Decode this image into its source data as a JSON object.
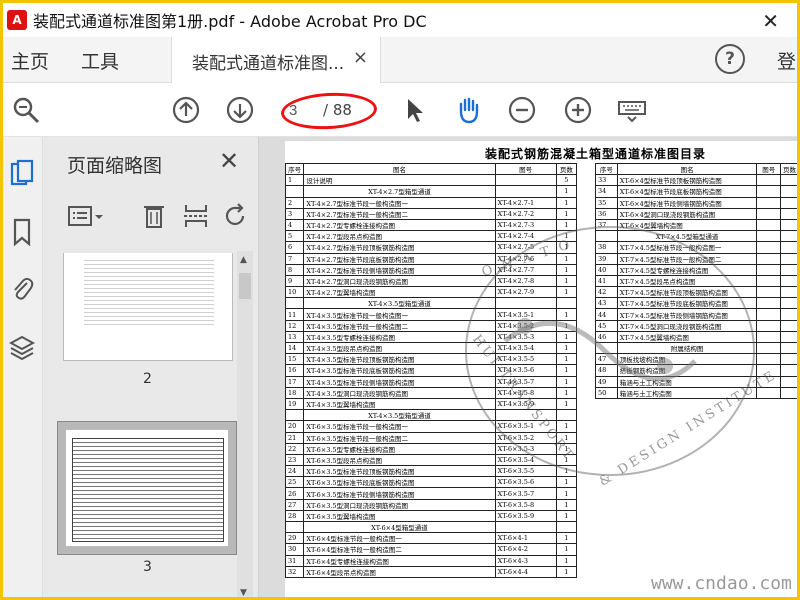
{
  "window": {
    "title": "装配式通道标准图第1册.pdf - Adobe Acrobat Pro DC",
    "close_glyph": "✕"
  },
  "tabbar": {
    "home": "主页",
    "tools": "工具",
    "doc_tab": "装配式通道标准图...",
    "doc_tab_close": "×",
    "help": "?",
    "login": "登"
  },
  "toolbar": {
    "page_current": "3",
    "page_total": "/ 88",
    "icons": [
      "zoom-icon",
      "prev-page-icon",
      "next-page-icon",
      "select-cursor-icon",
      "hand-icon",
      "zoom-out-icon",
      "zoom-in-icon",
      "keyboard-icon"
    ]
  },
  "thumbnails": {
    "title": "页面缩略图",
    "close": "✕",
    "pages": [
      {
        "label": "2"
      },
      {
        "label": "3"
      }
    ]
  },
  "document": {
    "title": "装配式钢筋混凝土箱型通道标准图目录",
    "left_headers": [
      "序号",
      "图名",
      "图号",
      "页数"
    ],
    "right_headers": [
      "序号",
      "图名",
      "图号",
      "页数"
    ],
    "left_rows": [
      {
        "no": "1",
        "name": "设计说明",
        "code": "",
        "pages": "5"
      },
      {
        "no": "",
        "name": "XT-4×2.7型箱型通道",
        "code": "",
        "pages": "1",
        "section": true
      },
      {
        "no": "2",
        "name": "XT-4×2.7型标准节段一般构造图一",
        "code": "XT-4×2.7-1",
        "pages": "1"
      },
      {
        "no": "3",
        "name": "XT-4×2.7型标准节段一般构造图二",
        "code": "XT-4×2.7-2",
        "pages": "1"
      },
      {
        "no": "4",
        "name": "XT-4×2.7型专螺栓连接构造图",
        "code": "XT-4×2.7-3",
        "pages": "1"
      },
      {
        "no": "5",
        "name": "XT-4×2.7型段吊点构造图",
        "code": "XT-4×2.7-4",
        "pages": "1"
      },
      {
        "no": "6",
        "name": "XT-4×2.7型标准节段顶板钢筋构造图",
        "code": "XT-4×2.7-5",
        "pages": "1"
      },
      {
        "no": "7",
        "name": "XT-4×2.7型标准节段底板钢筋构造图",
        "code": "XT-4×2.7-6",
        "pages": "1"
      },
      {
        "no": "8",
        "name": "XT-4×2.7型标准节段侧墙钢筋构造图",
        "code": "XT-4×2.7-7",
        "pages": "1"
      },
      {
        "no": "9",
        "name": "XT-4×2.7型洞口现浇段钢筋构造图",
        "code": "XT-4×2.7-8",
        "pages": "1"
      },
      {
        "no": "10",
        "name": "XT-4×2.7型翼墙构造图",
        "code": "XT-4×2.7-9",
        "pages": "1"
      },
      {
        "no": "",
        "name": "XT-4×3.5型箱型通道",
        "code": "",
        "pages": "",
        "section": true
      },
      {
        "no": "11",
        "name": "XT-4×3.5型标准节段一般构造图一",
        "code": "XT-4×3.5-1",
        "pages": "1"
      },
      {
        "no": "12",
        "name": "XT-4×3.5型标准节段一般构造图二",
        "code": "XT-4×3.5-2",
        "pages": "1"
      },
      {
        "no": "13",
        "name": "XT-4×3.5型专螺栓连接构造图",
        "code": "XT-4×3.5-3",
        "pages": "1"
      },
      {
        "no": "14",
        "name": "XT-4×3.5型段吊点构造图",
        "code": "XT-4×3.5-4",
        "pages": "1"
      },
      {
        "no": "15",
        "name": "XT-4×3.5型标准节段顶板钢筋构造图",
        "code": "XT-4×3.5-5",
        "pages": "1"
      },
      {
        "no": "16",
        "name": "XT-4×3.5型标准节段底板钢筋构造图",
        "code": "XT-4×3.5-6",
        "pages": "1"
      },
      {
        "no": "17",
        "name": "XT-4×3.5型标准节段侧墙钢筋构造图",
        "code": "XT-4×3.5-7",
        "pages": "1"
      },
      {
        "no": "18",
        "name": "XT-4×3.5型洞口现浇段钢筋构造图",
        "code": "XT-4×3.5-8",
        "pages": "1"
      },
      {
        "no": "19",
        "name": "XT-4×3.5型翼墙构造图",
        "code": "XT-4×3.5-9",
        "pages": "1"
      },
      {
        "no": "",
        "name": "XT-4×3.5型箱型通道",
        "code": "",
        "pages": "",
        "section": true
      },
      {
        "no": "20",
        "name": "XT-6×3.5型标准节段一般构造图一",
        "code": "XT-6×3.5-1",
        "pages": "1"
      },
      {
        "no": "21",
        "name": "XT-6×3.5型标准节段一般构造图二",
        "code": "XT-6×3.5-2",
        "pages": "1"
      },
      {
        "no": "22",
        "name": "XT-6×3.5型专螺栓连接构造图",
        "code": "XT-6×3.5-3",
        "pages": "1"
      },
      {
        "no": "23",
        "name": "XT-6×3.5型段吊点构造图",
        "code": "XT-6×3.5-4",
        "pages": "1"
      },
      {
        "no": "24",
        "name": "XT-6×3.5型标准节段顶板钢筋构造图",
        "code": "XT-6×3.5-5",
        "pages": "1"
      },
      {
        "no": "25",
        "name": "XT-6×3.5型标准节段底板钢筋构造图",
        "code": "XT-6×3.5-6",
        "pages": "1"
      },
      {
        "no": "26",
        "name": "XT-6×3.5型标准节段侧墙钢筋构造图",
        "code": "XT-6×3.5-7",
        "pages": "1"
      },
      {
        "no": "27",
        "name": "XT-6×3.5型洞口现浇段钢筋构造图",
        "code": "XT-6×3.5-8",
        "pages": "1"
      },
      {
        "no": "28",
        "name": "XT-6×3.5型翼墙构造图",
        "code": "XT-6×3.5-9",
        "pages": "1"
      },
      {
        "no": "",
        "name": "XT-6×4型箱型通道",
        "code": "",
        "pages": "",
        "section": true
      },
      {
        "no": "29",
        "name": "XT-6×4型标准节段一般构造图一",
        "code": "XT-6×4-1",
        "pages": "1"
      },
      {
        "no": "30",
        "name": "XT-6×4型标准节段一般构造图二",
        "code": "XT-6×4-2",
        "pages": "1"
      },
      {
        "no": "31",
        "name": "XT-6×4型专螺栓连接构造图",
        "code": "XT-6×4-3",
        "pages": "1"
      },
      {
        "no": "32",
        "name": "XT-6×4型段吊点构造图",
        "code": "XT-6×4-4",
        "pages": "1"
      }
    ],
    "right_rows": [
      {
        "no": "33",
        "name": "XT-6×4型标准节段顶板钢筋构造图"
      },
      {
        "no": "34",
        "name": "XT-6×4型标准节段底板钢筋构造图"
      },
      {
        "no": "35",
        "name": "XT-6×4型标准节段侧墙钢筋构造图"
      },
      {
        "no": "36",
        "name": "XT-6×4型洞口现浇段钢筋构造图"
      },
      {
        "no": "37",
        "name": "XT-6×4型翼墙构造图"
      },
      {
        "no": "",
        "name": "XT-7×4.5型箱型通道",
        "section": true
      },
      {
        "no": "38",
        "name": "XT-7×4.5型标准节段一般构造图一"
      },
      {
        "no": "39",
        "name": "XT-7×4.5型标准节段一般构造图二"
      },
      {
        "no": "40",
        "name": "XT-7×4.5型专螺栓连接构造图"
      },
      {
        "no": "41",
        "name": "XT-7×4.5型段吊点构造图"
      },
      {
        "no": "42",
        "name": "XT-7×4.5型标准节段顶板钢筋构造图"
      },
      {
        "no": "43",
        "name": "XT-7×4.5型标准节段底板钢筋构造图"
      },
      {
        "no": "44",
        "name": "XT-7×4.5型标准节段侧墙钢筋构造图"
      },
      {
        "no": "45",
        "name": "XT-7×4.5型洞口现浇段钢筋构造图"
      },
      {
        "no": "46",
        "name": "XT-7×4.5型翼墙构造图"
      },
      {
        "no": "",
        "name": "附属结构图",
        "section": true
      },
      {
        "no": "47",
        "name": "顶板找坡构造图"
      },
      {
        "no": "48",
        "name": "搭板钢筋构造图"
      },
      {
        "no": "49",
        "name": "箱涵与土工构造图"
      },
      {
        "no": "50",
        "name": "箱涵与土工构造图"
      }
    ]
  },
  "watermark_text": [
    "O N A T O",
    "HUI TRANSPORT",
    "& DESIGN INSTITUTE"
  ],
  "site_watermark": "www.cndao.com",
  "colors": {
    "frame": "#f5c400",
    "annotation": "#e11111",
    "panel": "#e9e9e9"
  }
}
